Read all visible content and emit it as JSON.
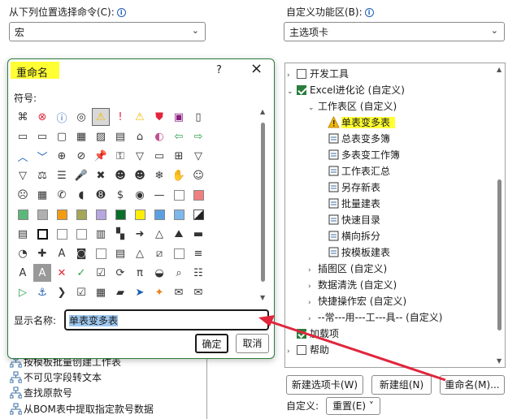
{
  "left_header": {
    "label": "从下列位置选择命令(C):",
    "combo_value": "宏"
  },
  "right_header": {
    "label": "自定义功能区(B):",
    "combo_value": "主选项卡"
  },
  "bg_list": [
    "按模板批量创建工作表",
    "不可见字段转文本",
    "查找原款号",
    "从BOM表中提取指定款号数据"
  ],
  "tree": {
    "items": [
      {
        "label": "开发工具",
        "level": 0,
        "checked": false,
        "arrow": "right"
      },
      {
        "label": "Excel进化论 (自定义)",
        "level": 0,
        "checked": true,
        "arrow": "down"
      },
      {
        "label": "工作表区 (自定义)",
        "level": 1,
        "arrow": "down"
      },
      {
        "label": "单表变多表",
        "level": 2,
        "icon": "warning-icon",
        "highlight": true
      },
      {
        "label": "总表变多簿",
        "level": 2,
        "icon": "table-split-icon"
      },
      {
        "label": "多表变工作簿",
        "level": 2,
        "icon": "sheets-icon"
      },
      {
        "label": "工作表汇总",
        "level": 2,
        "icon": "circle-left-icon"
      },
      {
        "label": "另存新表",
        "level": 2,
        "icon": "document-icon"
      },
      {
        "label": "批量建表",
        "level": 2,
        "icon": "batch-edit-icon"
      },
      {
        "label": "快速目录",
        "level": 2,
        "icon": "pages-icon"
      },
      {
        "label": "横向拆分",
        "level": 2,
        "icon": "ruler-icon"
      },
      {
        "label": "按模板建表",
        "level": 2,
        "icon": "target-icon"
      },
      {
        "label": "插图区 (自定义)",
        "level": 1,
        "arrow": "right"
      },
      {
        "label": "数据清洗 (自定义)",
        "level": 1,
        "arrow": "right"
      },
      {
        "label": "快捷操作宏 (自定义)",
        "level": 1,
        "arrow": "right"
      },
      {
        "label": "--常---用---工---具-- (自定义)",
        "level": 1,
        "arrow": "right"
      },
      {
        "label": "加载项",
        "level": 0,
        "checked": true
      },
      {
        "label": "帮助",
        "level": 0,
        "checked": false,
        "arrow": "right"
      }
    ]
  },
  "bottom_buttons": {
    "new_tab": "新建选项卡(W)",
    "new_group": "新建组(N)",
    "rename": "重命名(M)..."
  },
  "customize": {
    "label": "自定义:",
    "reset": "重置(E) ˅"
  },
  "dialog": {
    "title": "重命名",
    "help": "?",
    "close": "×",
    "symbol_label": "符号:",
    "display_name_label": "显示名称:",
    "display_name_value": "单表变多表",
    "ok": "确定",
    "cancel": "取消"
  },
  "symbols": [
    [
      "org",
      "x-circle",
      "info",
      "target",
      "warning",
      "!",
      "warning",
      "shield",
      "save",
      "doc"
    ],
    [
      "folder",
      "folder",
      "window",
      "grid",
      "image",
      "doc-lines",
      "house",
      "palette",
      "arrow-left-green",
      "arrow-right-green"
    ],
    [
      "chev-up",
      "chev-down",
      "arrow-right-circle",
      "no",
      "pin",
      "key",
      "filter",
      "monitor",
      "screen",
      "funnel"
    ],
    [
      "funnel",
      "scale",
      "list",
      "mic",
      "mute",
      "person",
      "person",
      "snowflake",
      "hand",
      "smile"
    ],
    [
      "frown",
      "calculator",
      "phone",
      "piggy",
      "8",
      "dollar",
      "eye",
      "dash",
      "sq-white",
      "sq-salmon"
    ],
    [
      "sq-green",
      "sq-gray",
      "sq-orange",
      "sq-olive",
      "sq-lavender",
      "sq-darkgreen",
      "sq-yellow",
      "sq-blue",
      "sq-blue2",
      "sq-blackwhite"
    ],
    [
      "grad",
      "sq-black",
      "sq-white2",
      "sq-white3",
      "sq-grad",
      "checker",
      "circle-arrow",
      "triangle",
      "mountain",
      "bars"
    ],
    [
      "pie",
      "puzzle",
      "text",
      "camera",
      "sq-white4",
      "chart",
      "triangles",
      "sq-slash",
      "sq-white5",
      "lines"
    ],
    [
      "A",
      "A-gray",
      "x-red",
      "check",
      "doc-check",
      "refresh",
      "pi",
      "bucket",
      "search",
      "list-bullets"
    ],
    [
      "play",
      "anchor",
      "chevron",
      "check-box",
      "doc-grid",
      "eraser",
      "cursor",
      "logo",
      "mail",
      "envelope"
    ]
  ],
  "colors": {
    "accent_green": "#2a7d3c",
    "highlight_yellow": "#ffff33",
    "arrow_red": "#e0263c"
  }
}
